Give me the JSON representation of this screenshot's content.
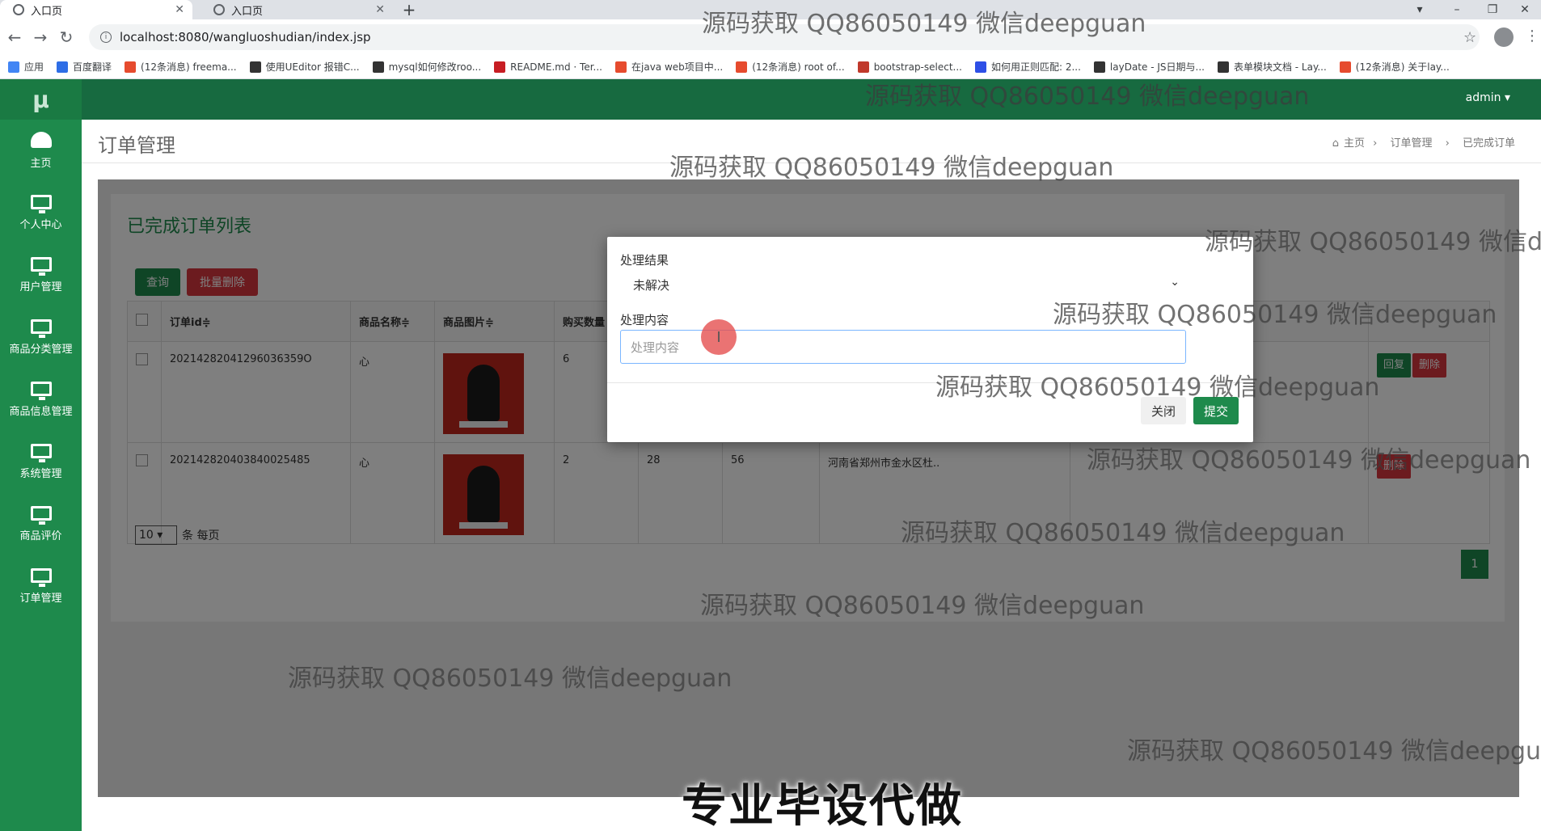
{
  "browser": {
    "tabs": [
      {
        "title": "入口页",
        "active": true
      },
      {
        "title": "入口页",
        "active": false
      }
    ],
    "url": "localhost:8080/wangluoshudian/index.jsp",
    "bookmarks": [
      {
        "label": "应用",
        "color": "#4285f4"
      },
      {
        "label": "百度翻译",
        "color": "#2e6ee6"
      },
      {
        "label": "(12条消息) freema...",
        "color": "#e64b2e"
      },
      {
        "label": "使用UEditor 报错C...",
        "color": "#333333"
      },
      {
        "label": "mysql如何修改roo...",
        "color": "#333333"
      },
      {
        "label": "README.md · Ter...",
        "color": "#c71d23"
      },
      {
        "label": "在java web项目中...",
        "color": "#e64b2e"
      },
      {
        "label": "(12条消息) root of...",
        "color": "#e64b2e"
      },
      {
        "label": "bootstrap-select...",
        "color": "#c0392b"
      },
      {
        "label": "如何用正则匹配: 2...",
        "color": "#2e4fe6"
      },
      {
        "label": "layDate - JS日期与...",
        "color": "#333333"
      },
      {
        "label": "表单模块文档 - Lay...",
        "color": "#333333"
      },
      {
        "label": "(12条消息) 关于lay...",
        "color": "#e64b2e"
      }
    ]
  },
  "app": {
    "logo": "μ",
    "admin": "admin ▾",
    "sidebar": [
      {
        "label": "主页",
        "icon": "dashboard-icon"
      },
      {
        "label": "个人中心",
        "icon": "monitor-icon"
      },
      {
        "label": "用户管理",
        "icon": "monitor-icon"
      },
      {
        "label": "商品分类管理",
        "icon": "monitor-icon"
      },
      {
        "label": "商品信息管理",
        "icon": "monitor-icon"
      },
      {
        "label": "系统管理",
        "icon": "monitor-icon"
      },
      {
        "label": "商品评价",
        "icon": "monitor-icon"
      },
      {
        "label": "订单管理",
        "icon": "monitor-icon"
      }
    ],
    "page_title": "订单管理",
    "breadcrumb": [
      "主页",
      "订单管理",
      "已完成订单"
    ],
    "panel_title": "已完成订单列表",
    "buttons": {
      "query": "查询",
      "batch_delete": "批量删除"
    },
    "table": {
      "headers": [
        "订单id≑",
        "商品名称≑",
        "商品图片≑",
        "购买数量"
      ],
      "rows": [
        {
          "id": "20214282041296036359O",
          "name": "心",
          "qty": "6",
          "extra": [
            "",
            "",
            ""
          ],
          "actions": [
            "回复",
            "删除"
          ]
        },
        {
          "id": "20214282040384002548​5",
          "name": "心",
          "qty": "2",
          "extra": [
            "28",
            "56",
            "河南省郑州市金水区杜.."
          ],
          "actions": [
            "删除"
          ]
        }
      ]
    },
    "page_size": "10",
    "page_size_suffix": "条 每页",
    "current_page": "1"
  },
  "modal": {
    "result_label": "处理结果",
    "result_value": "未解决",
    "content_label": "处理内容",
    "content_placeholder": "处理内容",
    "close_label": "关闭",
    "submit_label": "提交"
  },
  "overlay_text": {
    "watermark": "源码获取 QQ86050149 微信deepguan",
    "promo": "专业毕设代做"
  },
  "colors": {
    "brand": "#1e8a4c",
    "danger": "#d9363e"
  }
}
